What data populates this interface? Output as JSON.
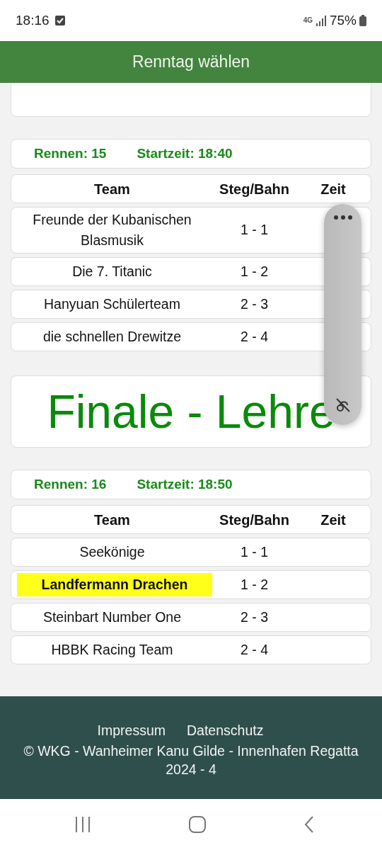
{
  "status_bar": {
    "time": "18:16",
    "network": "4G",
    "battery": "75%"
  },
  "app_bar": {
    "title": "Renntag wählen"
  },
  "sections": [
    {
      "race": "Rennen: 15",
      "start": "Startzeit: 18:40",
      "columns": [
        "Team",
        "Steg/Bahn",
        "Zeit"
      ],
      "rows": [
        {
          "team": "Freunde der Kubanischen Blasmusik",
          "lane": "1 - 1",
          "highlighted": false
        },
        {
          "team": "Die 7. Titanic",
          "lane": "1 - 2",
          "highlighted": false
        },
        {
          "team": "Hanyuan Schülerteam",
          "lane": "2 - 3",
          "highlighted": false
        },
        {
          "team": "die schnellen Drewitze",
          "lane": "2 - 4",
          "highlighted": false
        }
      ]
    },
    {
      "heading": "Finale - Lehre",
      "race": "Rennen: 16",
      "start": "Startzeit: 18:50",
      "columns": [
        "Team",
        "Steg/Bahn",
        "Zeit"
      ],
      "rows": [
        {
          "team": "Seekönige",
          "lane": "1 - 1",
          "highlighted": false
        },
        {
          "team": "Landfermann Drachen",
          "lane": "1 - 2",
          "highlighted": true
        },
        {
          "team": "Steinbart Number One",
          "lane": "2 - 3",
          "highlighted": false
        },
        {
          "team": "HBBK Racing Team",
          "lane": "2 - 4",
          "highlighted": false
        }
      ]
    }
  ],
  "footer": {
    "links": [
      "Impressum",
      "Datenschutz"
    ],
    "copyright": "© WKG - Wanheimer Kanu Gilde - Innenhafen Regatta 2024 - 4"
  }
}
